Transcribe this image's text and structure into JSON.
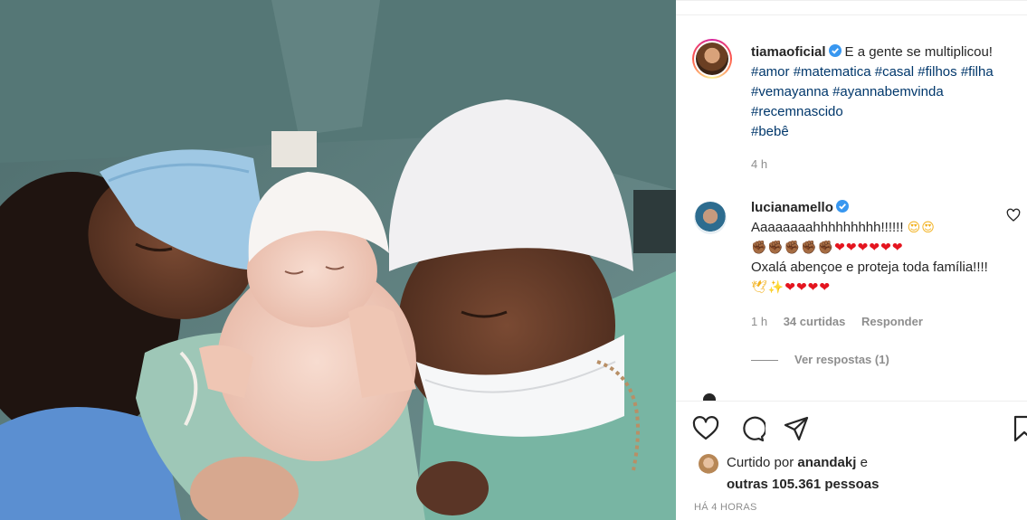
{
  "post": {
    "author": "tiamaoficial",
    "caption_text": "E a gente se multiplicou!",
    "hashtags": [
      "#amor",
      "#matematica",
      "#casal",
      "#filhos",
      "#filha",
      "#vemayanna",
      "#ayannabemvinda",
      "#recemnascido",
      "#bebê"
    ],
    "time_ago": "4 h"
  },
  "comment": {
    "author": "lucianamello",
    "text_1": "Aaaaaaaahhhhhhhhh!!!!!!",
    "emoji_line_1": "😍😍",
    "emoji_fists": "✊🏾✊🏾✊🏾✊🏾✊🏾",
    "emoji_hearts": "❤❤❤❤❤❤",
    "text_2": "Oxalá abençoe e proteja toda família!!!!",
    "emoji_end_1": "🕊✨",
    "emoji_end_hearts": "❤❤❤❤",
    "time_ago": "1 h",
    "likes": "34 curtidas",
    "reply_label": "Responder",
    "view_replies": "Ver respostas (1)"
  },
  "likes": {
    "prefix": "Curtido por",
    "user": "anandakj",
    "connector": "e",
    "others": "outras 105.361 pessoas"
  },
  "posted_label": "HÁ 4 HORAS",
  "icons": [
    "verified-icon",
    "heart-icon",
    "comment-icon",
    "share-icon",
    "bookmark-icon",
    "comment-like-heart-icon"
  ],
  "colors": {
    "text": "#262626",
    "secondary": "#8e8e8e",
    "hashtag": "#00376b",
    "verified": "#3897f0",
    "heart": "#e4151f"
  }
}
